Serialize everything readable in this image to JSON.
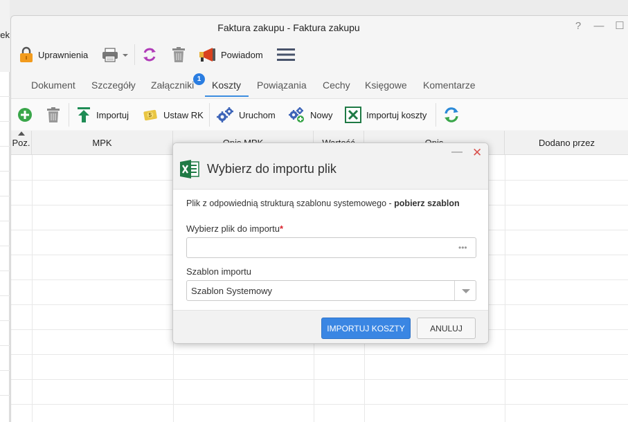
{
  "background": {
    "fragment_text": "rek"
  },
  "window": {
    "title": "Faktura zakupu - Faktura zakupu",
    "controls": {
      "help": "?",
      "minimize": "—",
      "maximize": "☐"
    }
  },
  "toolbar": {
    "permissions_label": "Uprawnienia",
    "notify_label": "Powiadom"
  },
  "tabs": [
    {
      "label": "Dokument"
    },
    {
      "label": "Szczegóły"
    },
    {
      "label": "Załączniki",
      "badge": "1"
    },
    {
      "label": "Koszty",
      "active": true
    },
    {
      "label": "Powiązania"
    },
    {
      "label": "Cechy"
    },
    {
      "label": "Księgowe"
    },
    {
      "label": "Komentarze"
    }
  ],
  "subtoolbar": {
    "import_label": "Importuj",
    "set_rk_label": "Ustaw RK",
    "run_label": "Uruchom",
    "new_label": "Nowy",
    "import_costs_label": "Importuj koszty"
  },
  "grid": {
    "columns": [
      "Poz.",
      "MPK",
      "Opis MPK",
      "Wartość",
      "Opis",
      "Dodano przez"
    ]
  },
  "modal": {
    "title": "Wybierz do importu plik",
    "hint_text": "Plik z odpowiednią strukturą szablonu systemowego - ",
    "hint_link": "pobierz szablon",
    "file_label": "Wybierz plik do importu",
    "required_mark": "*",
    "file_value": "",
    "file_browse": "•••",
    "template_label": "Szablon importu",
    "template_value": "Szablon Systemowy",
    "import_button": "IMPORTUJ KOSZTY",
    "cancel_button": "ANULUJ",
    "minimize": "—",
    "close": "✕"
  },
  "colors": {
    "accent": "#3a86e3",
    "close_red": "#d9534f",
    "required_red": "#d9232d",
    "excel_green": "#1f7a45",
    "add_green": "#3aa64a"
  }
}
